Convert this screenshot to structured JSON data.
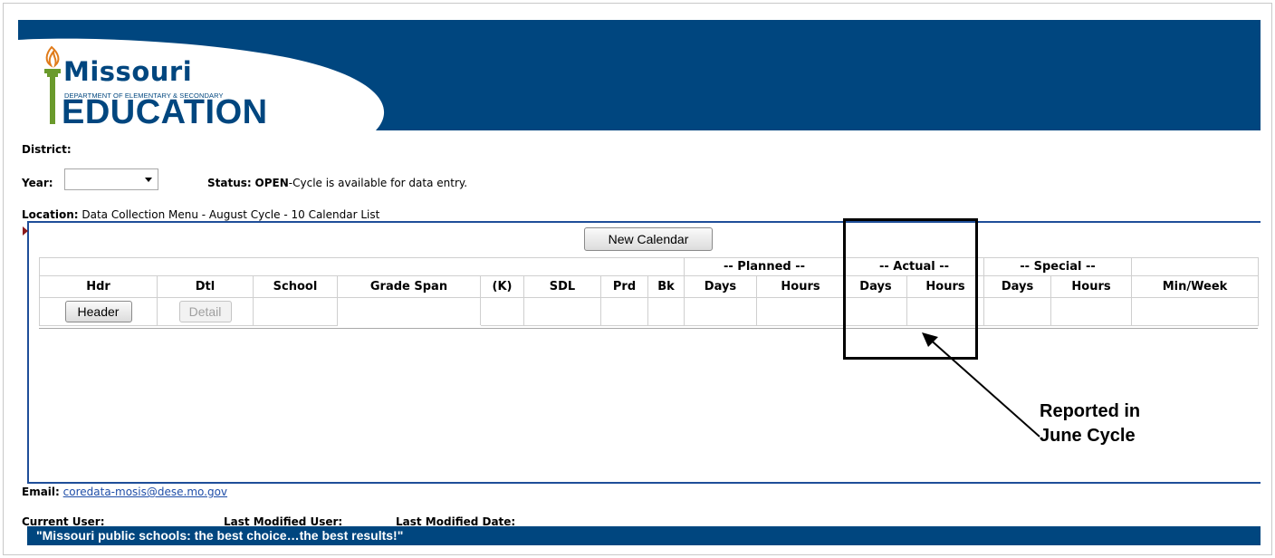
{
  "banner": {
    "logo_missouri": "Missouri",
    "logo_department": "DEPARTMENT OF ELEMENTARY & SECONDARY",
    "logo_education": "EDUCATION",
    "colors": {
      "brand_blue": "#00467f"
    }
  },
  "info": {
    "district_label": "District:",
    "year_label": "Year:",
    "year_value": "",
    "status_label": "Status:",
    "status_value": "OPEN",
    "status_text": "-Cycle is available for data entry.",
    "location_label": "Location:",
    "location_value": "Data Collection Menu - August Cycle - 10 Calendar List"
  },
  "actions": {
    "new_calendar": "New Calendar"
  },
  "table": {
    "groups": {
      "planned": "-- Planned --",
      "actual": "-- Actual --",
      "special": "-- Special --"
    },
    "headers": [
      "Hdr",
      "Dtl",
      "School",
      "Grade Span",
      "(K)",
      "SDL",
      "Prd",
      "Bk",
      "Days",
      "Hours",
      "Days",
      "Hours",
      "Days",
      "Hours",
      "Min/Week"
    ],
    "row": {
      "header_button": "Header",
      "detail_button": "Detail"
    }
  },
  "callout": {
    "line1": "Reported in",
    "line2": "June Cycle"
  },
  "footer": {
    "email_label": "Email:",
    "email_link": "coredata-mosis@dese.mo.gov",
    "current_user_label": "Current User:",
    "last_modified_user_label": "Last Modified User:",
    "last_modified_date_label": "Last Modified Date:",
    "motto": "\"Missouri public schools: the best choice…the best results!\""
  }
}
